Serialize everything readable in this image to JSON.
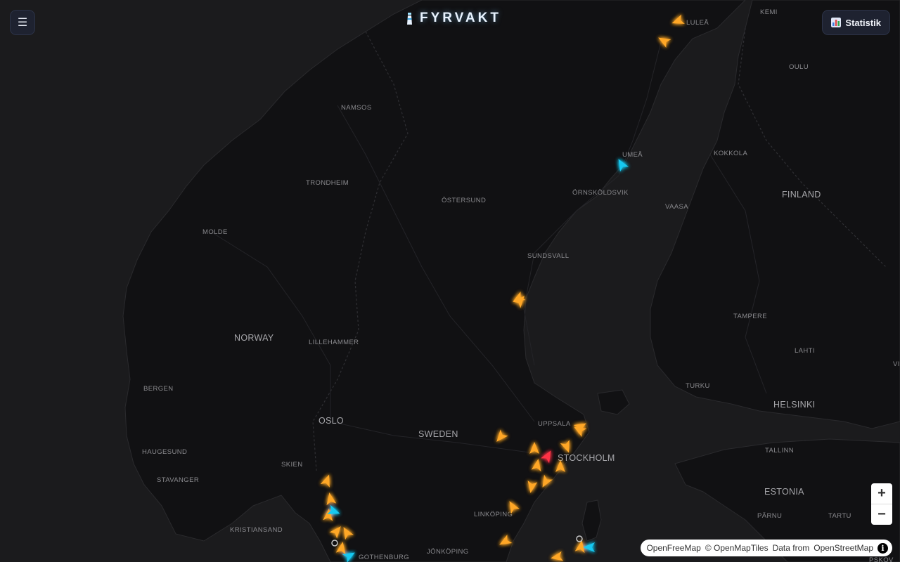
{
  "app": {
    "title": "FYRVAKT"
  },
  "header": {
    "menu_icon": "☰",
    "stats_label": "Statistik"
  },
  "map": {
    "labels": {
      "kemi": "KEMI",
      "lulea": "LULEÅ",
      "oulu": "OULU",
      "namsos": "NAMSOS",
      "umea": "UMEÅ",
      "kokkola": "KOKKOLA",
      "trondheim": "TRONDHEIM",
      "ostersund": "ÖSTERSUND",
      "ornskoldsvik": "ÖRNSKÖLDSVIK",
      "finland": "FINLAND",
      "vaasa": "VAASA",
      "molde": "MOLDE",
      "sundsvall": "SUNDSVALL",
      "tampere": "TAMPERE",
      "norway": "NORWAY",
      "lillehammer": "LILLEHAMMER",
      "lahti": "LAHTI",
      "bergen": "BERGEN",
      "turku": "TURKU",
      "helsinki": "HELSINKI",
      "oslo": "OSLO",
      "uppsala": "UPPSALA",
      "sweden": "SWEDEN",
      "haugesund": "HAUGESUND",
      "tallinn": "TALLINN",
      "stockholm": "STOCKHOLM",
      "skien": "SKIEN",
      "stavanger": "STAVANGER",
      "estonia": "ESTONIA",
      "linkoping": "LINKÖPING",
      "parnu": "PÄRNU",
      "tartu": "TARTU",
      "kristiansand": "KRISTIANSAND",
      "jonkoping": "JÖNKÖPING",
      "gothenburg": "GOTHENBURG",
      "pskov": "PSKOV",
      "vi": "VI"
    },
    "marker_colors": {
      "orange": "#ffa726",
      "cyan": "#18c8f0",
      "red": "#ff3344"
    }
  },
  "zoom": {
    "in_label": "+",
    "out_label": "−"
  },
  "attribution": {
    "openfreemap": "OpenFreeMap",
    "copy_openmaptiles": "© OpenMapTiles",
    "data_from": "Data from",
    "openstreetmap": "OpenStreetMap",
    "info_label": "i"
  }
}
